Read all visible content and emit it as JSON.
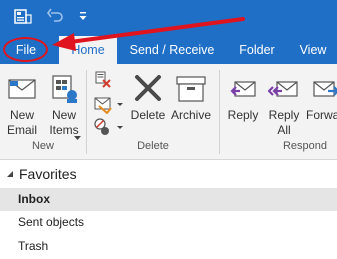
{
  "qat": {
    "outlook_icon": "outlook-icon",
    "undo_icon": "undo-icon",
    "customize_icon": "qat-dropdown-icon"
  },
  "tabs": [
    {
      "label": "File",
      "active": false
    },
    {
      "label": "Home",
      "active": true
    },
    {
      "label": "Send / Receive",
      "active": false
    },
    {
      "label": "Folder",
      "active": false
    },
    {
      "label": "View",
      "active": false
    }
  ],
  "ribbon": {
    "new_group": {
      "label": "New",
      "new_email_line1": "New",
      "new_email_line2": "Email",
      "new_items_line1": "New",
      "new_items_line2": "Items"
    },
    "delete_group": {
      "label": "Delete",
      "delete_label": "Delete",
      "archive_label": "Archive"
    },
    "respond_group": {
      "label": "Respond",
      "reply_label": "Reply",
      "reply_all_line1": "Reply",
      "reply_all_line2": "All",
      "forward_label": "Forwa"
    }
  },
  "folder_pane": {
    "favorites_label": "Favorites",
    "folders": [
      {
        "label": "Inbox",
        "selected": true
      },
      {
        "label": "Sent objects",
        "selected": false
      },
      {
        "label": "Trash",
        "selected": false
      }
    ]
  },
  "colors": {
    "brand_blue": "#1f6fc6",
    "annotation_red": "#e0141e",
    "ribbon_bg": "#f3f3f3",
    "selected_folder_bg": "#e5e5e5"
  }
}
